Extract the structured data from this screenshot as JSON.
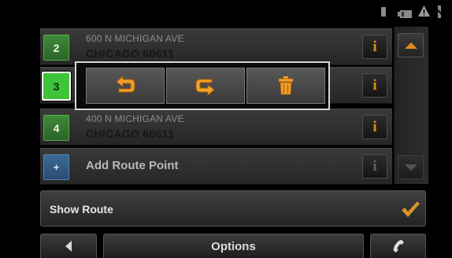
{
  "route_points": [
    {
      "number": "2",
      "address": "600 N MICHIGAN AVE",
      "city": "CHICAGO 60611"
    },
    {
      "number": "3"
    },
    {
      "number": "4",
      "address": "400 N MICHIGAN AVE",
      "city": "CHICAGO 60611"
    }
  ],
  "add_point": {
    "number": "+",
    "label": "Add Route Point"
  },
  "info_label": "i",
  "show_route": {
    "label": "Show Route"
  },
  "toolbar": {
    "options_label": "Options"
  },
  "icons": {
    "status": [
      "bookmark-icon",
      "battery-icon",
      "warning-icon",
      "no-signal-icon"
    ],
    "popup": [
      "move-up-icon",
      "move-down-icon",
      "delete-icon"
    ],
    "confirm": "checkmark-icon",
    "back": "back-arrow-icon",
    "phone": "phone-icon"
  },
  "colors": {
    "accent": "#e08b1f",
    "badge_green": "#3f8a3a",
    "badge_highlight": "#3ec43a",
    "badge_blue": "#3b6a98"
  }
}
